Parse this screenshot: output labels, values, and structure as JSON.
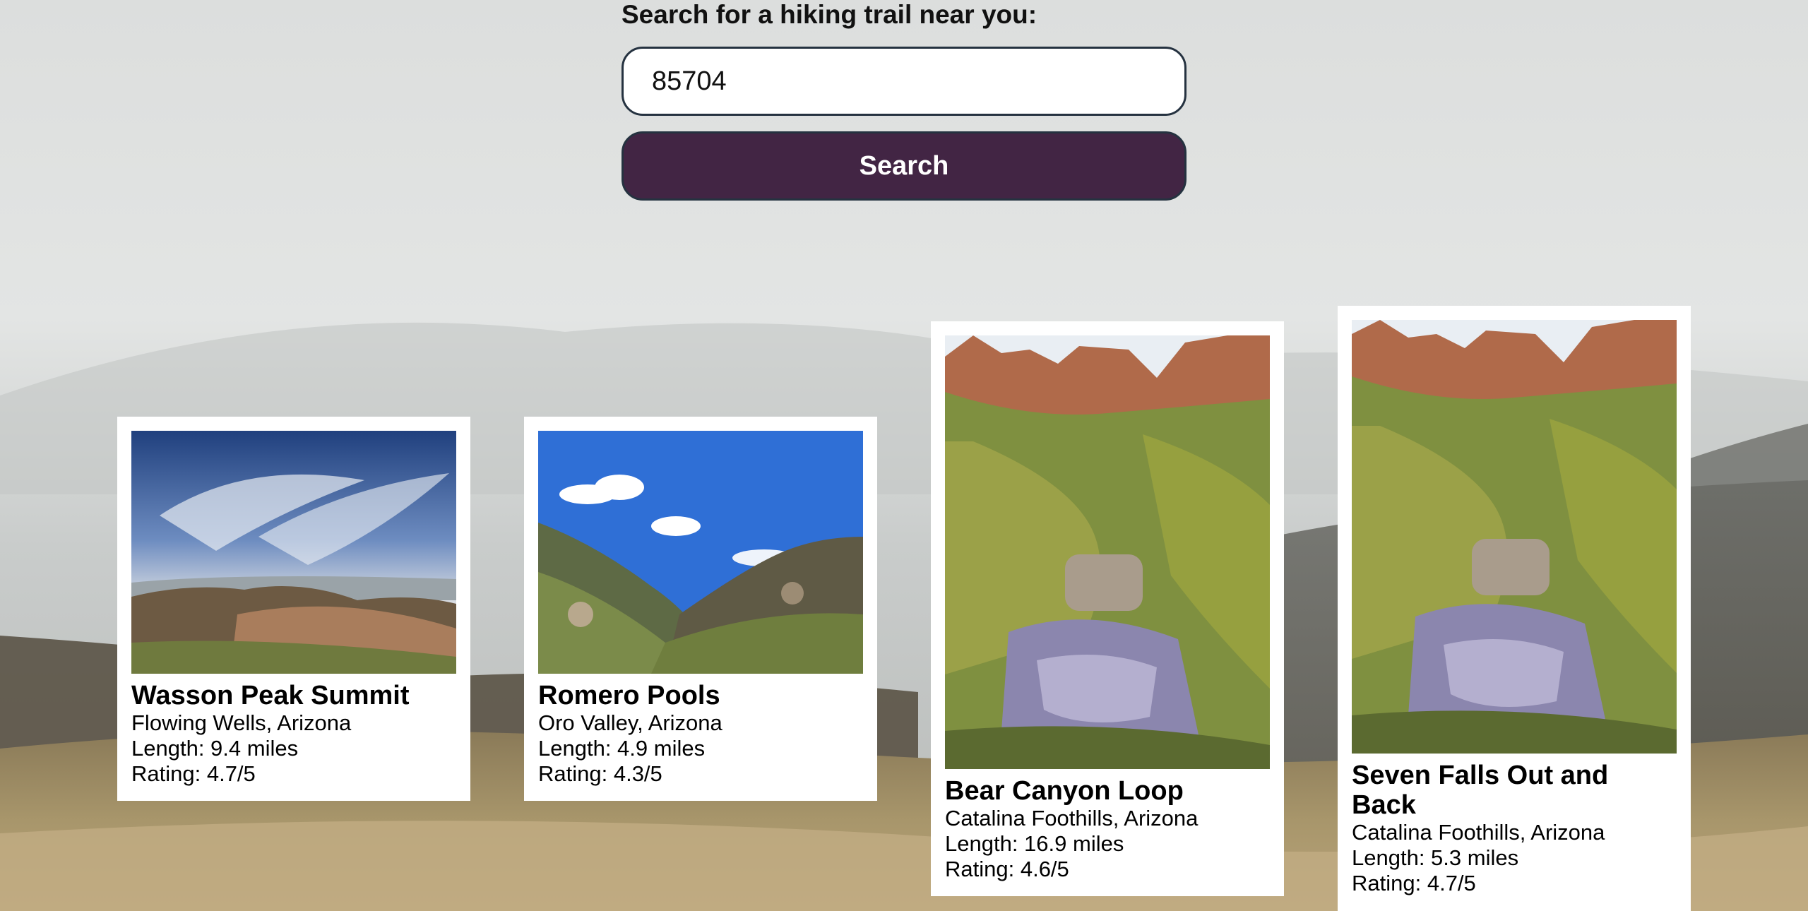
{
  "search": {
    "label": "Search for a hiking trail near you:",
    "value": "85704",
    "button_label": "Search"
  },
  "colors": {
    "button_bg": "#422544",
    "border": "#253240",
    "card_bg": "#ffffff"
  },
  "trails": [
    {
      "name": "Wasson Peak Summit",
      "location": "Flowing Wells, Arizona",
      "length": "Length: 9.4 miles",
      "rating": "Rating: 4.7/5"
    },
    {
      "name": "Romero Pools",
      "location": "Oro Valley, Arizona",
      "length": "Length: 4.9 miles",
      "rating": "Rating: 4.3/5"
    },
    {
      "name": "Bear Canyon Loop",
      "location": "Catalina Foothills, Arizona",
      "length": "Length: 16.9 miles",
      "rating": "Rating: 4.6/5"
    },
    {
      "name": "Seven Falls Out and Back",
      "location": "Catalina Foothills, Arizona",
      "length": "Length: 5.3 miles",
      "rating": "Rating: 4.7/5"
    }
  ]
}
